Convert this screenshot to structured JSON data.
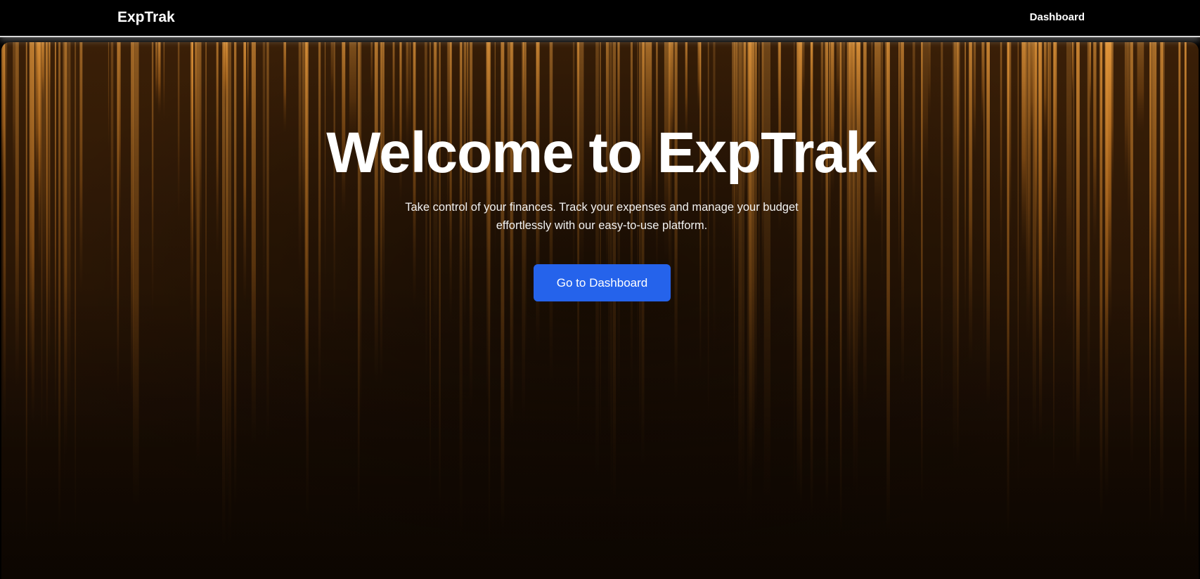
{
  "navbar": {
    "brand": "ExpTrak",
    "links": [
      {
        "label": "Dashboard"
      }
    ]
  },
  "hero": {
    "title": "Welcome to ExpTrak",
    "subtitle": "Take control of your finances. Track your expenses and manage your budget effortlessly with our easy-to-use platform.",
    "cta_label": "Go to Dashboard"
  },
  "colors": {
    "navbar_bg": "#000000",
    "accent": "#2563eb",
    "streak_gold": "#c77a24",
    "background_dark": "#1a0d03"
  }
}
